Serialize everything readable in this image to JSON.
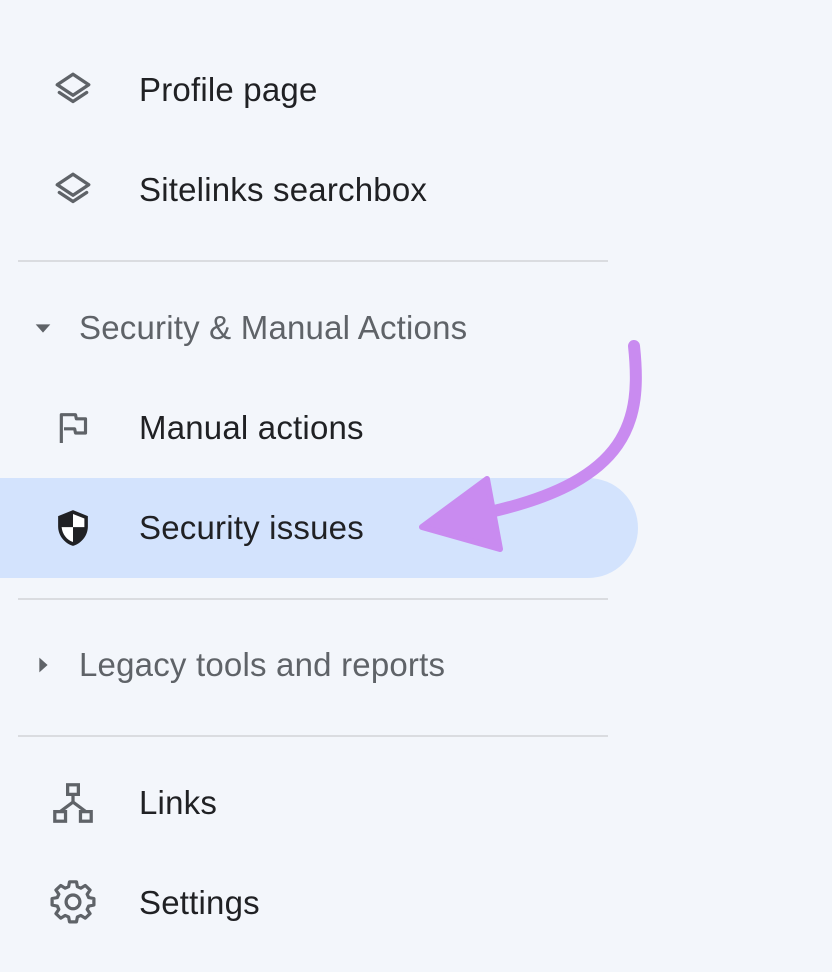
{
  "nav": {
    "items_top": [
      {
        "label": "Profile page",
        "icon": "layers-icon"
      },
      {
        "label": "Sitelinks searchbox",
        "icon": "layers-icon"
      }
    ],
    "security_section": {
      "label": "Security & Manual Actions",
      "expanded": true,
      "items": [
        {
          "label": "Manual actions",
          "icon": "flag-icon"
        },
        {
          "label": "Security issues",
          "icon": "shield-icon",
          "active": true
        }
      ]
    },
    "legacy_section": {
      "label": "Legacy tools and reports",
      "expanded": false
    },
    "items_bottom": [
      {
        "label": "Links",
        "icon": "links-icon"
      },
      {
        "label": "Settings",
        "icon": "gear-icon"
      }
    ]
  },
  "colors": {
    "background": "#f3f6fb",
    "active_item": "#d3e3fd",
    "annotation_arrow": "#c98bf0",
    "text_primary": "#202124",
    "text_section": "#5f6368",
    "icon": "#5f6368",
    "divider": "#dadce0"
  }
}
